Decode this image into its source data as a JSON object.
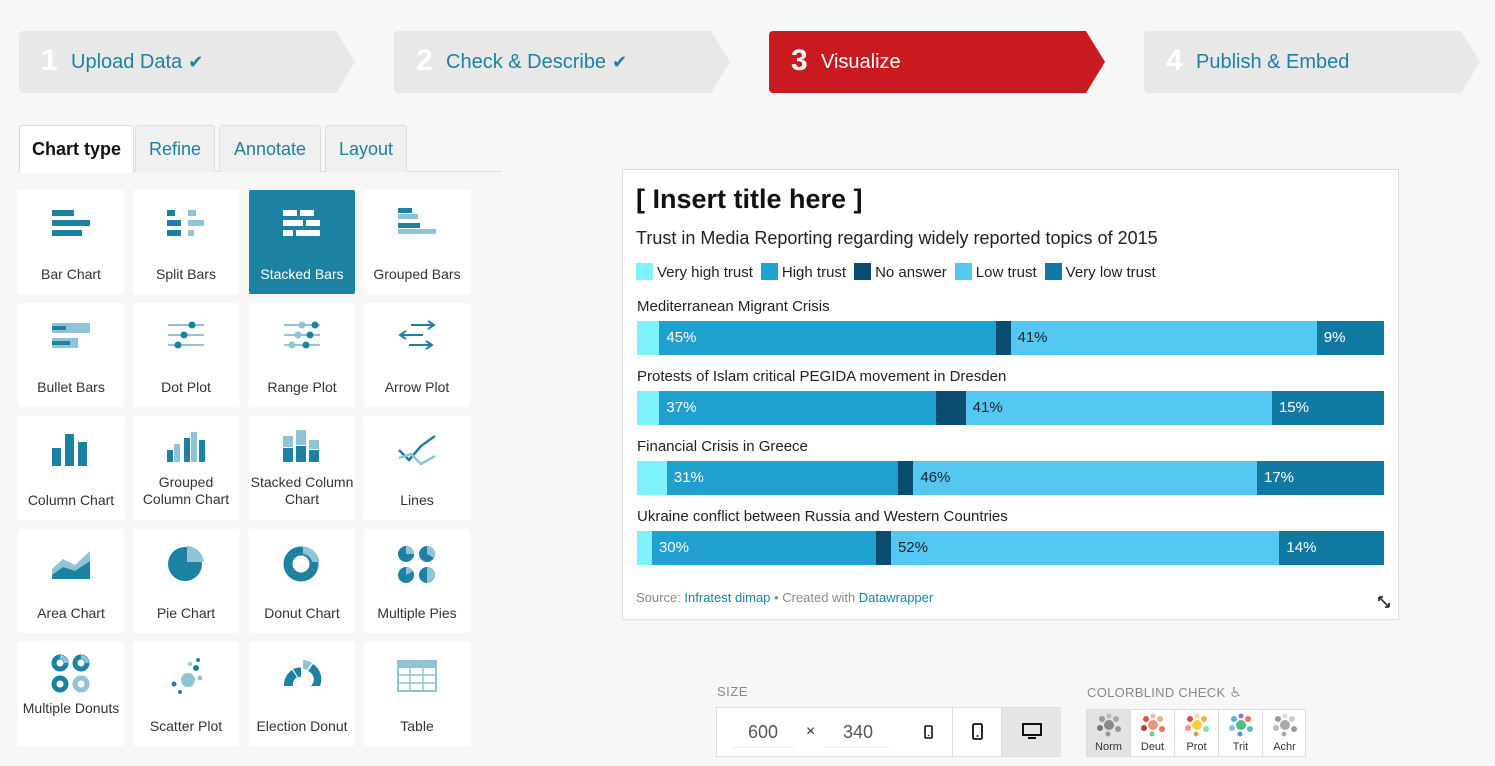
{
  "steps": [
    {
      "num": "1",
      "label": "Upload Data",
      "done": true
    },
    {
      "num": "2",
      "label": "Check & Describe",
      "done": true
    },
    {
      "num": "3",
      "label": "Visualize",
      "done": false
    },
    {
      "num": "4",
      "label": "Publish & Embed",
      "done": false
    }
  ],
  "tabs": [
    "Chart type",
    "Refine",
    "Annotate",
    "Layout"
  ],
  "chart_types": [
    {
      "label": "Bar Chart",
      "icon": "bar-chart-icon"
    },
    {
      "label": "Split Bars",
      "icon": "split-bars-icon"
    },
    {
      "label": "Stacked Bars",
      "icon": "stacked-bars-icon",
      "selected": true
    },
    {
      "label": "Grouped Bars",
      "icon": "grouped-bars-icon"
    },
    {
      "label": "Bullet Bars",
      "icon": "bullet-bars-icon"
    },
    {
      "label": "Dot Plot",
      "icon": "dot-plot-icon"
    },
    {
      "label": "Range Plot",
      "icon": "range-plot-icon"
    },
    {
      "label": "Arrow Plot",
      "icon": "arrow-plot-icon"
    },
    {
      "label": "Column Chart",
      "icon": "column-chart-icon"
    },
    {
      "label": "Grouped Column Chart",
      "icon": "grouped-column-chart-icon"
    },
    {
      "label": "Stacked Column Chart",
      "icon": "stacked-column-chart-icon"
    },
    {
      "label": "Lines",
      "icon": "lines-icon"
    },
    {
      "label": "Area Chart",
      "icon": "area-chart-icon"
    },
    {
      "label": "Pie Chart",
      "icon": "pie-chart-icon"
    },
    {
      "label": "Donut Chart",
      "icon": "donut-chart-icon"
    },
    {
      "label": "Multiple Pies",
      "icon": "multiple-pies-icon"
    },
    {
      "label": "Multiple Donuts",
      "icon": "multiple-donuts-icon"
    },
    {
      "label": "Scatter Plot",
      "icon": "scatter-plot-icon"
    },
    {
      "label": "Election Donut",
      "icon": "election-donut-icon"
    },
    {
      "label": "Table",
      "icon": "table-icon"
    }
  ],
  "chart_data": {
    "type": "bar",
    "title": "[ Insert title here ]",
    "subtitle": "Trust in Media Reporting regarding widely reported topics of 2015",
    "legend_position": "top-left",
    "categories": [
      "Mediterranean Migrant Crisis",
      "Protests of Islam critical PEGIDA movement in Dresden",
      "Financial Crisis in Greece",
      "Ukraine conflict between Russia and Western Countries"
    ],
    "series": [
      {
        "name": "Very high trust",
        "color": "#7ef2fb",
        "values": [
          3,
          3,
          4,
          2
        ]
      },
      {
        "name": "High trust",
        "color": "#1fa0cf",
        "values": [
          45,
          37,
          31,
          30
        ]
      },
      {
        "name": "No answer",
        "color": "#0b4d70",
        "values": [
          2,
          4,
          2,
          2
        ]
      },
      {
        "name": "Low trust",
        "color": "#54c7f3",
        "values": [
          41,
          41,
          46,
          52
        ]
      },
      {
        "name": "Very low trust",
        "color": "#0f79a2",
        "values": [
          9,
          15,
          17,
          14
        ]
      }
    ],
    "labels": [
      [
        "",
        "45%",
        "",
        "41%",
        "9%"
      ],
      [
        "",
        "37%",
        "",
        "41%",
        "15%"
      ],
      [
        "",
        "31%",
        "",
        "46%",
        "17%"
      ],
      [
        "",
        "30%",
        "",
        "52%",
        "14%"
      ]
    ],
    "label_colors": [
      "#222",
      "#fff",
      "#fff",
      "#222",
      "#fff"
    ],
    "xlim": [
      0,
      100
    ]
  },
  "source": {
    "prefix": "Source: ",
    "name": "Infratest dimap",
    "middle": " • Created with ",
    "tool": "Datawrapper"
  },
  "size": {
    "label": "SIZE",
    "width": "600",
    "times": "×",
    "height": "340"
  },
  "colorblind": {
    "label": "COLORBLIND CHECK",
    "modes": [
      "Norm",
      "Deut",
      "Prot",
      "Trit",
      "Achr"
    ]
  },
  "colors": {
    "accent": "#1d81a2",
    "active_step": "#c91a1f"
  }
}
